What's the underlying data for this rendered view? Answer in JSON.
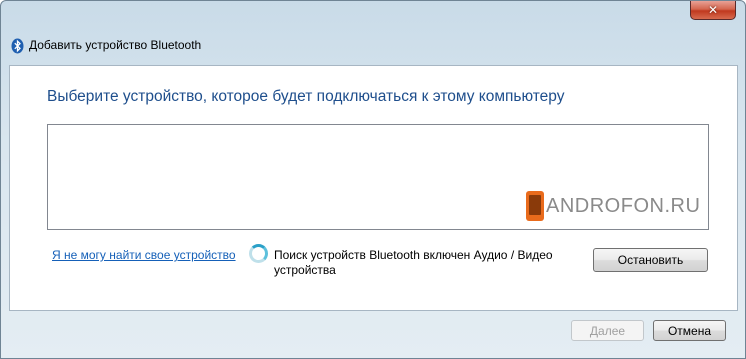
{
  "window": {
    "title": "Добавить устройство Bluetooth",
    "close_glyph": "✕",
    "title_icon": "bluetooth-icon"
  },
  "main": {
    "heading": "Выберите устройство, которое будет подключаться к этому компьютеру",
    "watermark_text": "ANDROFON.RU"
  },
  "footer_row": {
    "cant_find_link": "Я не могу найти свое устройство",
    "status_text": "Поиск устройств Bluetooth включен Аудио / Видео устройства",
    "stop_button": "Остановить"
  },
  "buttons": {
    "next": "Далее",
    "cancel": "Отмена"
  },
  "colors": {
    "heading": "#1e4e8c",
    "link": "#1560b8",
    "watermark_logo": "#e96b1c"
  }
}
